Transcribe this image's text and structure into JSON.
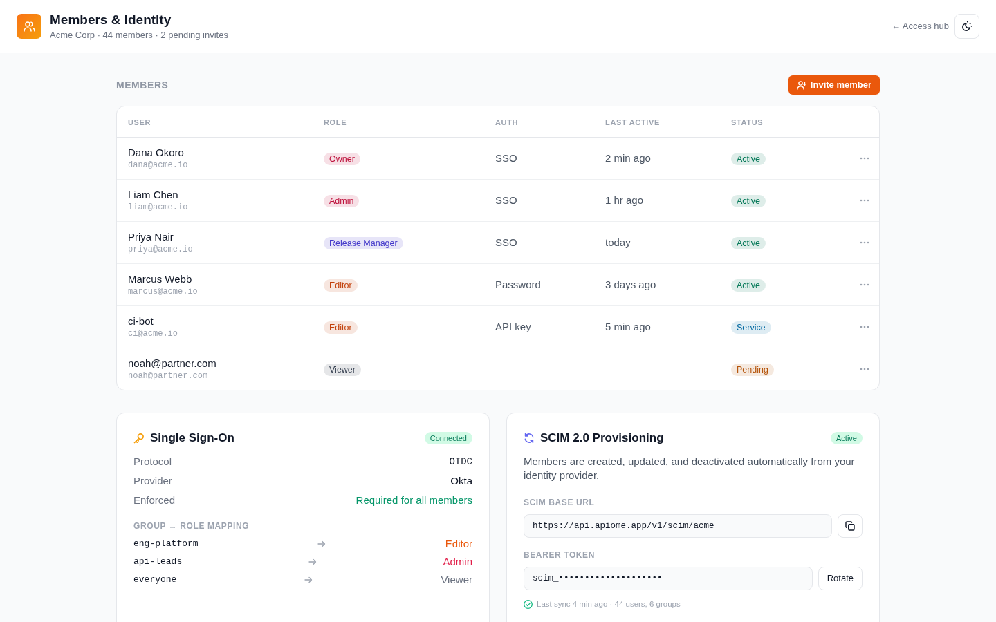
{
  "header": {
    "title": "Members & Identity",
    "subtitle": "Acme Corp · 44 members · 2 pending invites",
    "back_link": "← Access hub"
  },
  "members": {
    "heading": "MEMBERS",
    "invite_button": "Invite member",
    "columns": [
      "USER",
      "ROLE",
      "AUTH",
      "LAST ACTIVE",
      "STATUS"
    ],
    "rows": [
      {
        "name": "Dana Okoro",
        "email": "dana@acme.io",
        "role": {
          "label": "Owner",
          "color": "#be123c"
        },
        "auth": "SSO",
        "last_active": "2 min ago",
        "status": {
          "label": "Active",
          "color": "#047857"
        }
      },
      {
        "name": "Liam Chen",
        "email": "liam@acme.io",
        "role": {
          "label": "Admin",
          "color": "#be123c"
        },
        "auth": "SSO",
        "last_active": "1 hr ago",
        "status": {
          "label": "Active",
          "color": "#047857"
        }
      },
      {
        "name": "Priya Nair",
        "email": "priya@acme.io",
        "role": {
          "label": "Release Manager",
          "color": "#4338ca"
        },
        "auth": "SSO",
        "last_active": "today",
        "status": {
          "label": "Active",
          "color": "#047857"
        }
      },
      {
        "name": "Marcus Webb",
        "email": "marcus@acme.io",
        "role": {
          "label": "Editor",
          "color": "#c2410c"
        },
        "auth": "Password",
        "last_active": "3 days ago",
        "status": {
          "label": "Active",
          "color": "#047857"
        }
      },
      {
        "name": "ci-bot",
        "email": "ci@acme.io",
        "role": {
          "label": "Editor",
          "color": "#c2410c"
        },
        "auth": "API key",
        "last_active": "5 min ago",
        "status": {
          "label": "Service",
          "color": "#0369a1"
        }
      },
      {
        "name": "noah@partner.com",
        "email": "noah@partner.com",
        "role": {
          "label": "Viewer",
          "color": "#374151"
        },
        "auth": "—",
        "last_active": "—",
        "status": {
          "label": "Pending",
          "color": "#b45309"
        }
      }
    ]
  },
  "sso": {
    "title": "Single Sign-On",
    "badge": "Connected",
    "fields": [
      {
        "label": "Protocol",
        "value": "OIDC",
        "kind": "code"
      },
      {
        "label": "Provider",
        "value": "Okta",
        "kind": "text"
      },
      {
        "label": "Enforced",
        "value": "Required for all members",
        "kind": "positive"
      }
    ],
    "mapping_heading": "GROUP → ROLE MAPPING",
    "mappings": [
      {
        "group": "eng-platform",
        "role": "Editor",
        "color": "#ea580c"
      },
      {
        "group": "api-leads",
        "role": "Admin",
        "color": "#e11d48"
      },
      {
        "group": "everyone",
        "role": "Viewer",
        "color": "#6b7280"
      }
    ]
  },
  "scim": {
    "title": "SCIM 2.0 Provisioning",
    "badge": "Active",
    "description": "Members are created, updated, and deactivated automatically from your identity provider.",
    "base_url_label": "SCIM BASE URL",
    "base_url": "https://api.apiome.app/v1/scim/acme",
    "token_label": "BEARER TOKEN",
    "token": "scim_••••••••••••••••••••",
    "rotate_button": "Rotate",
    "sync_note": "Last sync 4 min ago · 44 users, 6 groups"
  }
}
